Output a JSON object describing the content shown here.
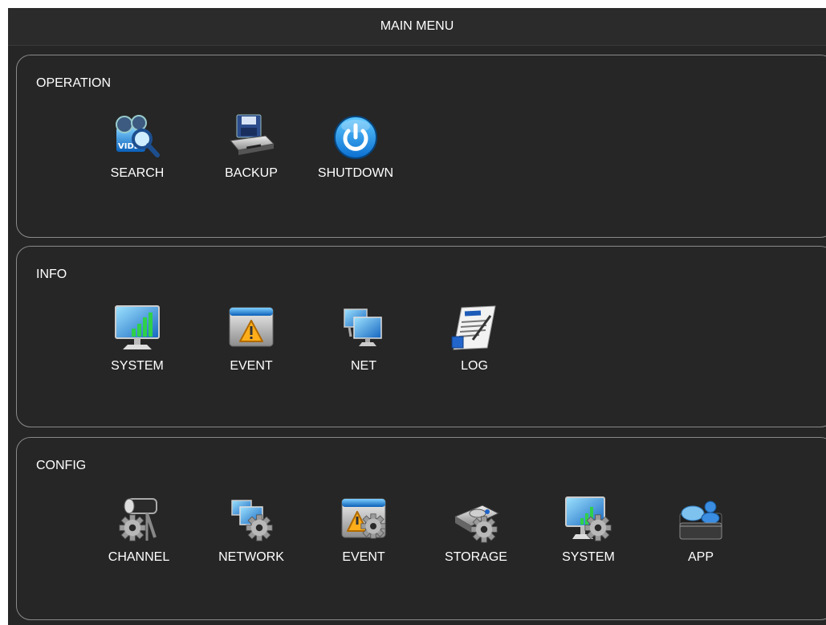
{
  "title": "MAIN MENU",
  "sections": {
    "operation": {
      "title": "OPERATION",
      "items": [
        {
          "label": "SEARCH",
          "icon": "video-search-icon"
        },
        {
          "label": "BACKUP",
          "icon": "backup-drive-icon"
        },
        {
          "label": "SHUTDOWN",
          "icon": "power-icon"
        }
      ]
    },
    "info": {
      "title": "INFO",
      "items": [
        {
          "label": "SYSTEM",
          "icon": "monitor-chart-icon"
        },
        {
          "label": "EVENT",
          "icon": "warning-window-icon"
        },
        {
          "label": "NET",
          "icon": "network-monitors-icon"
        },
        {
          "label": "LOG",
          "icon": "log-document-icon"
        }
      ]
    },
    "config": {
      "title": "CONFIG",
      "items": [
        {
          "label": "CHANNEL",
          "icon": "camera-gear-icon"
        },
        {
          "label": "NETWORK",
          "icon": "network-gear-icon"
        },
        {
          "label": "EVENT",
          "icon": "warning-gear-icon"
        },
        {
          "label": "STORAGE",
          "icon": "storage-gear-icon"
        },
        {
          "label": "SYSTEM",
          "icon": "monitor-gear-icon"
        },
        {
          "label": "APP",
          "icon": "app-folder-icon"
        }
      ]
    }
  },
  "colors": {
    "background": "#262626",
    "border": "#8a8a8a",
    "text": "#ffffff",
    "accent_blue": "#1a8fe3"
  }
}
